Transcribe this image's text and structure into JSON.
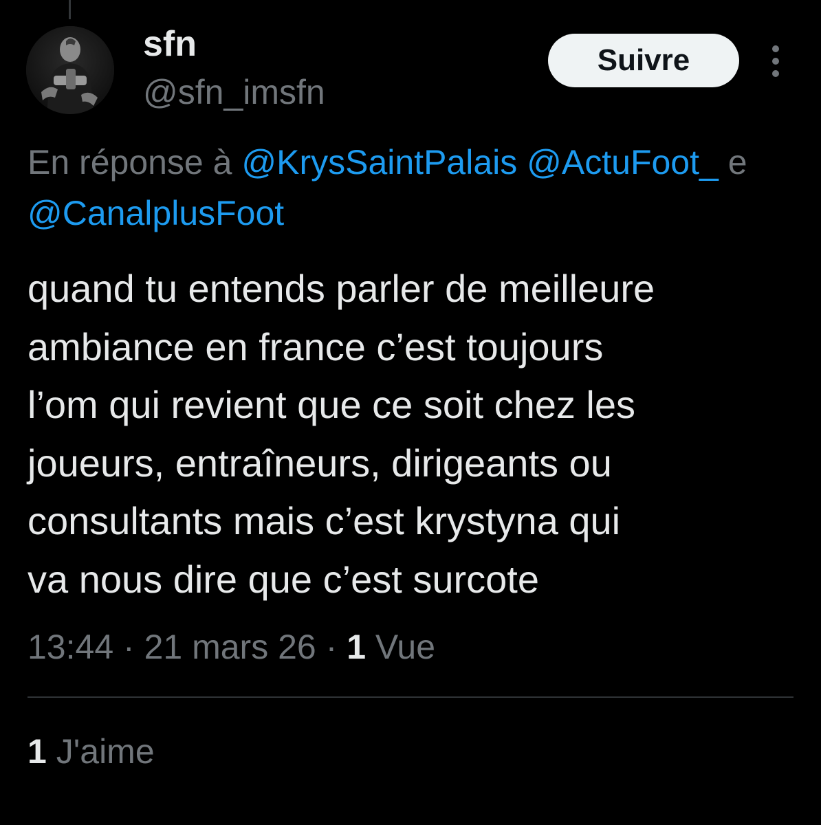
{
  "author": {
    "display_name": "sfn",
    "handle": "@sfn_imsfn",
    "avatar_icon": "profile-photo"
  },
  "follow_button": {
    "label": "Suivre"
  },
  "more_button": {
    "icon": "more-vertical-icon"
  },
  "reply": {
    "prefix": "En réponse à",
    "mentions": [
      "@KrysSaintPalais",
      "@ActuFoot_",
      "@CanalplusFoot"
    ],
    "connector": "e"
  },
  "tweet": {
    "lines": [
      "quand tu entends parler de meilleure",
      "ambiance en france c’est toujours",
      "l’om qui revient que ce soit chez les",
      "joueurs, entraîneurs, dirigeants ou",
      "consultants mais c’est krystyna qui",
      "va nous dire que c’est surcote"
    ]
  },
  "meta": {
    "time": "13:44",
    "separator": "·",
    "date": "21 mars 26",
    "views_count": "1",
    "views_label": "Vue"
  },
  "engagement": {
    "likes_count": "1",
    "likes_label": "J'aime"
  },
  "colors": {
    "background": "#000000",
    "text_primary": "#e7e9ea",
    "text_secondary": "#71767b",
    "link": "#1d9bf0",
    "button_bg": "#eff3f4"
  }
}
